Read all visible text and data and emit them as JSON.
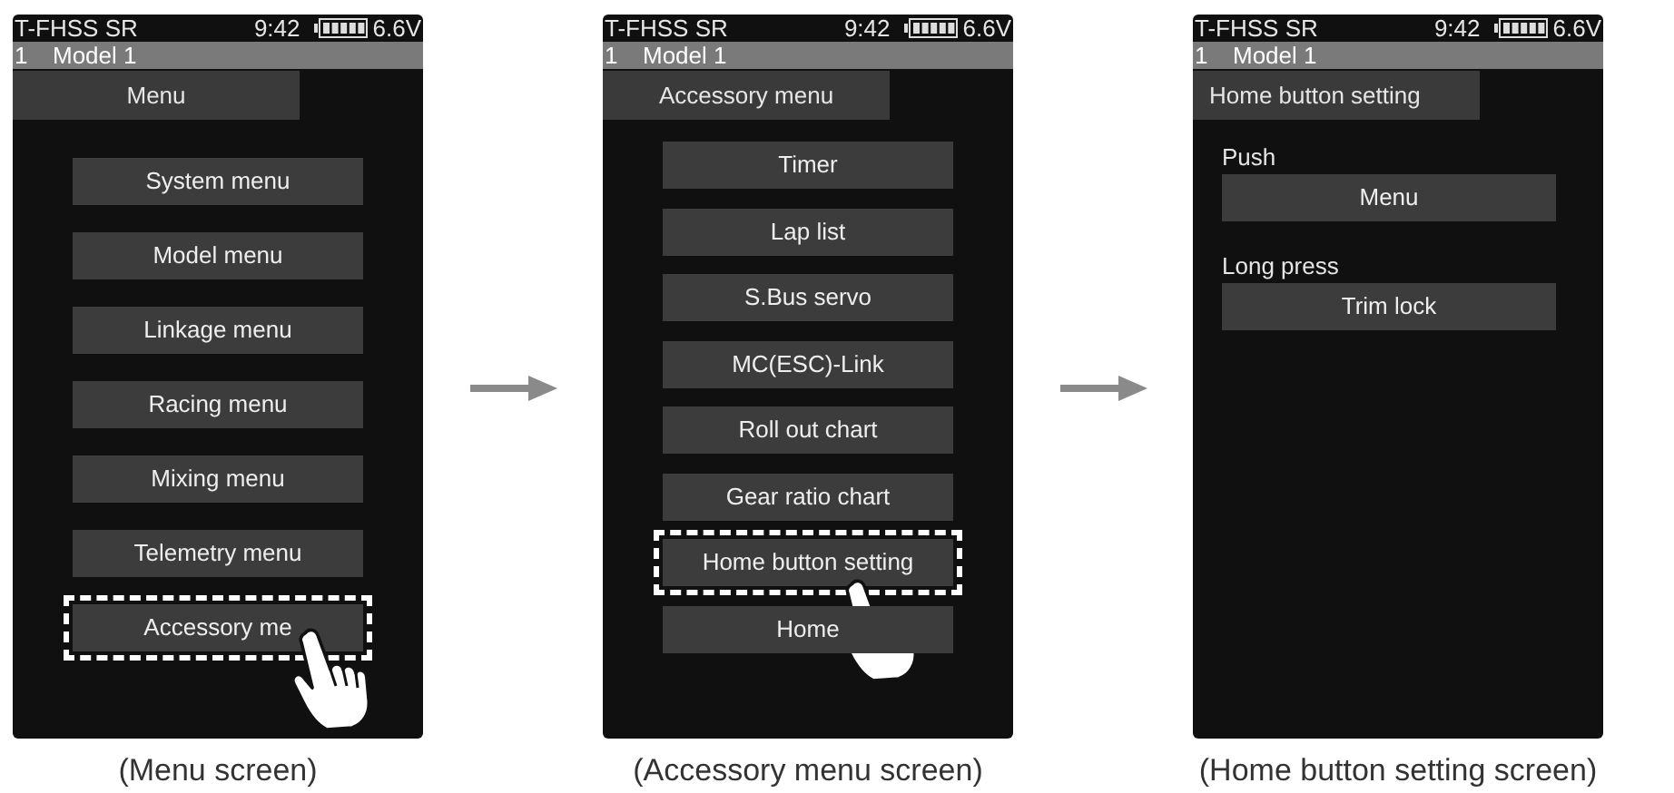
{
  "screens": [
    {
      "status": {
        "system": "T-FHSS SR",
        "time": "9:42",
        "voltage": "6.6V"
      },
      "model": {
        "number": "1",
        "name": "Model 1"
      },
      "title": "Menu",
      "kind": "menu",
      "items": [
        {
          "label": "System menu",
          "highlighted": false
        },
        {
          "label": "Model menu",
          "highlighted": false
        },
        {
          "label": "Linkage menu",
          "highlighted": false
        },
        {
          "label": "Racing menu",
          "highlighted": false
        },
        {
          "label": "Mixing menu",
          "highlighted": false
        },
        {
          "label": "Telemetry menu",
          "highlighted": false
        },
        {
          "label": "Accessory me",
          "highlighted": true
        }
      ],
      "caption": "(Menu screen)"
    },
    {
      "status": {
        "system": "T-FHSS SR",
        "time": "9:42",
        "voltage": "6.6V"
      },
      "model": {
        "number": "1",
        "name": "Model 1"
      },
      "title": "Accessory menu",
      "kind": "menu",
      "items": [
        {
          "label": "Timer",
          "highlighted": false
        },
        {
          "label": "Lap list",
          "highlighted": false
        },
        {
          "label": "S.Bus servo",
          "highlighted": false
        },
        {
          "label": "MC(ESC)-Link",
          "highlighted": false
        },
        {
          "label": "Roll out chart",
          "highlighted": false
        },
        {
          "label": "Gear ratio chart",
          "highlighted": false
        },
        {
          "label": "Home button setting",
          "highlighted": true
        },
        {
          "label": "Home",
          "highlighted": false
        }
      ],
      "caption": "(Accessory menu screen)"
    },
    {
      "status": {
        "system": "T-FHSS SR",
        "time": "9:42",
        "voltage": "6.6V"
      },
      "model": {
        "number": "1",
        "name": "Model 1"
      },
      "title": "Home button setting",
      "kind": "settings",
      "settings": [
        {
          "label": "Push",
          "value": "Menu"
        },
        {
          "label": "Long press",
          "value": "Trim lock"
        }
      ],
      "caption": "(Home button setting screen)"
    }
  ]
}
